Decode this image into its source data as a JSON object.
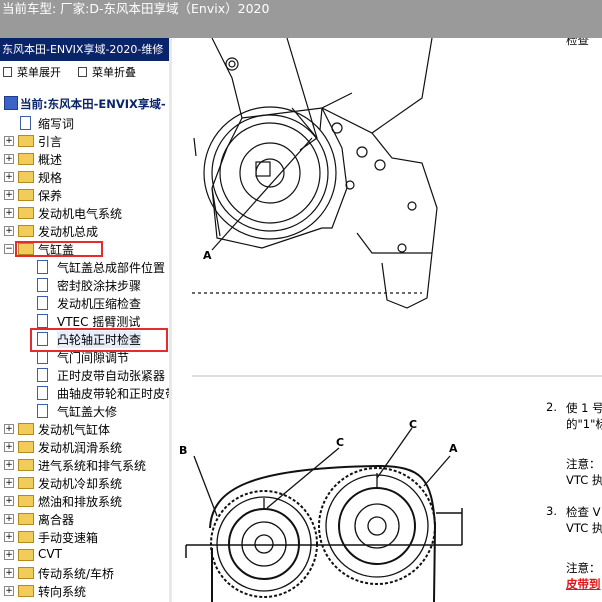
{
  "window": {
    "title": "当前车型:  厂家:D-东风本田享域（Envix）2020"
  },
  "sidebar": {
    "header": "东风本田-ENVIX享域-2020-维修",
    "expand_label": "菜单展开",
    "collapse_label": "菜单折叠",
    "root_label": "当前:东风本田-ENVIX享域-",
    "items": [
      {
        "label": "缩写词",
        "type": "doc"
      },
      {
        "label": "引言",
        "type": "folder",
        "toggle": "+"
      },
      {
        "label": "概述",
        "type": "folder",
        "toggle": "+"
      },
      {
        "label": "规格",
        "type": "folder",
        "toggle": "+"
      },
      {
        "label": "保养",
        "type": "folder",
        "toggle": "+"
      },
      {
        "label": "发动机电气系统",
        "type": "folder",
        "toggle": "+"
      },
      {
        "label": "发动机总成",
        "type": "folder",
        "toggle": "+"
      },
      {
        "label": "气缸盖",
        "type": "folder",
        "toggle": "-"
      },
      {
        "label": "气缸盖总成部件位置",
        "type": "doc",
        "level": 2
      },
      {
        "label": "密封胶涂抹步骤",
        "type": "doc",
        "level": 2
      },
      {
        "label": "发动机压缩检查",
        "type": "doc",
        "level": 2
      },
      {
        "label": "VTEC 摇臂测试",
        "type": "doc",
        "level": 2
      },
      {
        "label": "凸轮轴正时检查",
        "type": "doc",
        "level": 2,
        "selected": true
      },
      {
        "label": "气门间隙调节",
        "type": "doc",
        "level": 2
      },
      {
        "label": "正时皮带自动张紧器",
        "type": "doc",
        "level": 2
      },
      {
        "label": "曲轴皮带轮和正时皮带",
        "type": "doc",
        "level": 2
      },
      {
        "label": "气缸盖大修",
        "type": "doc",
        "level": 2
      },
      {
        "label": "发动机气缸体",
        "type": "folder",
        "toggle": "+"
      },
      {
        "label": "发动机润滑系统",
        "type": "folder",
        "toggle": "+"
      },
      {
        "label": "进气系统和排气系统",
        "type": "folder",
        "toggle": "+"
      },
      {
        "label": "发动机冷却系统",
        "type": "folder",
        "toggle": "+"
      },
      {
        "label": "燃油和排放系统",
        "type": "folder",
        "toggle": "+"
      },
      {
        "label": "离合器",
        "type": "folder",
        "toggle": "+"
      },
      {
        "label": "手动变速箱",
        "type": "folder",
        "toggle": "+"
      },
      {
        "label": "CVT",
        "type": "folder",
        "toggle": "+"
      },
      {
        "label": "传动系统/车桥",
        "type": "folder",
        "toggle": "+"
      },
      {
        "label": "转向系统",
        "type": "folder",
        "toggle": "+"
      }
    ]
  },
  "content": {
    "top_right_text": "检查",
    "step2_num": "2.",
    "step2_line1": "使 1 号",
    "step2_line2": "的\"1\"标",
    "note1_label": "注意：",
    "note1_text": "VTC 执",
    "step3_num": "3.",
    "step3_line1": "检查 V",
    "step3_line2": "VTC 执",
    "note2_label": "注意：",
    "link_text": "皮带到",
    "figure1": {
      "callout_a": "A"
    },
    "figure2": {
      "callout_b": "B",
      "callout_c1": "C",
      "callout_c2": "C",
      "callout_a": "A"
    }
  }
}
